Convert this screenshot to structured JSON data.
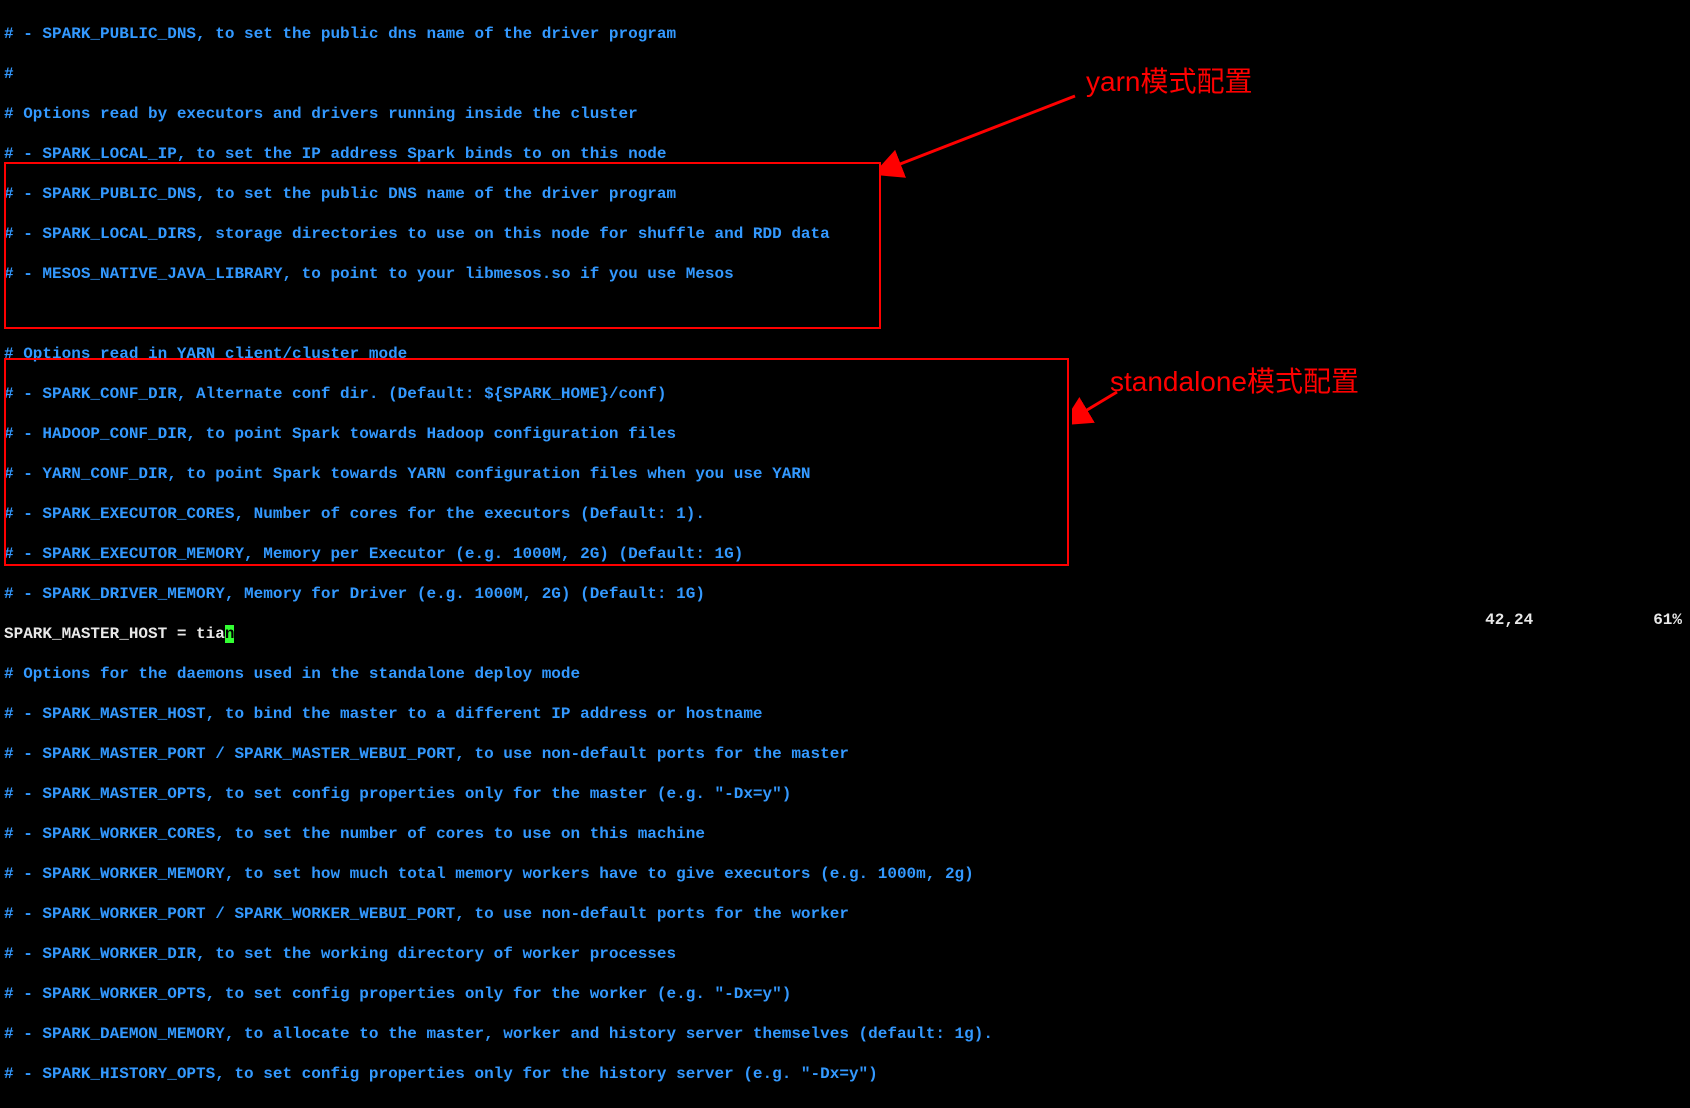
{
  "lines": {
    "l0": "# - SPARK_PUBLIC_DNS, to set the public dns name of the driver program",
    "l1": "#",
    "l2": "# Options read by executors and drivers running inside the cluster",
    "l3": "# - SPARK_LOCAL_IP, to set the IP address Spark binds to on this node",
    "l4": "# - SPARK_PUBLIC_DNS, to set the public DNS name of the driver program",
    "l5": "# - SPARK_LOCAL_DIRS, storage directories to use on this node for shuffle and RDD data",
    "l6": "# - MESOS_NATIVE_JAVA_LIBRARY, to point to your libmesos.so if you use Mesos",
    "l7": "",
    "l8": "# Options read in YARN client/cluster mode",
    "l9": "# - SPARK_CONF_DIR, Alternate conf dir. (Default: ${SPARK_HOME}/conf)",
    "l10": "# - HADOOP_CONF_DIR, to point Spark towards Hadoop configuration files",
    "l11": "# - YARN_CONF_DIR, to point Spark towards YARN configuration files when you use YARN",
    "l12": "# - SPARK_EXECUTOR_CORES, Number of cores for the executors (Default: 1).",
    "l13": "# - SPARK_EXECUTOR_MEMORY, Memory per Executor (e.g. 1000M, 2G) (Default: 1G)",
    "l14": "# - SPARK_DRIVER_MEMORY, Memory for Driver (e.g. 1000M, 2G) (Default: 1G)",
    "l15a": "SPARK_MASTER_HOST = tia",
    "l15b": "n",
    "l16": "# Options for the daemons used in the standalone deploy mode",
    "l17": "# - SPARK_MASTER_HOST, to bind the master to a different IP address or hostname",
    "l18": "# - SPARK_MASTER_PORT / SPARK_MASTER_WEBUI_PORT, to use non-default ports for the master",
    "l19": "# - SPARK_MASTER_OPTS, to set config properties only for the master (e.g. \"-Dx=y\")",
    "l20": "# - SPARK_WORKER_CORES, to set the number of cores to use on this machine",
    "l21": "# - SPARK_WORKER_MEMORY, to set how much total memory workers have to give executors (e.g. 1000m, 2g)",
    "l22": "# - SPARK_WORKER_PORT / SPARK_WORKER_WEBUI_PORT, to use non-default ports for the worker",
    "l23": "# - SPARK_WORKER_DIR, to set the working directory of worker processes",
    "l24": "# - SPARK_WORKER_OPTS, to set config properties only for the worker (e.g. \"-Dx=y\")",
    "l25": "# - SPARK_DAEMON_MEMORY, to allocate to the master, worker and history server themselves (default: 1g).",
    "l26": "# - SPARK_HISTORY_OPTS, to set config properties only for the history server (e.g. \"-Dx=y\")"
  },
  "annotations": {
    "yarn_label": "yarn模式配置",
    "standalone_label": "standalone模式配置"
  },
  "status": {
    "cursor": "42,24",
    "percent": "61%"
  }
}
